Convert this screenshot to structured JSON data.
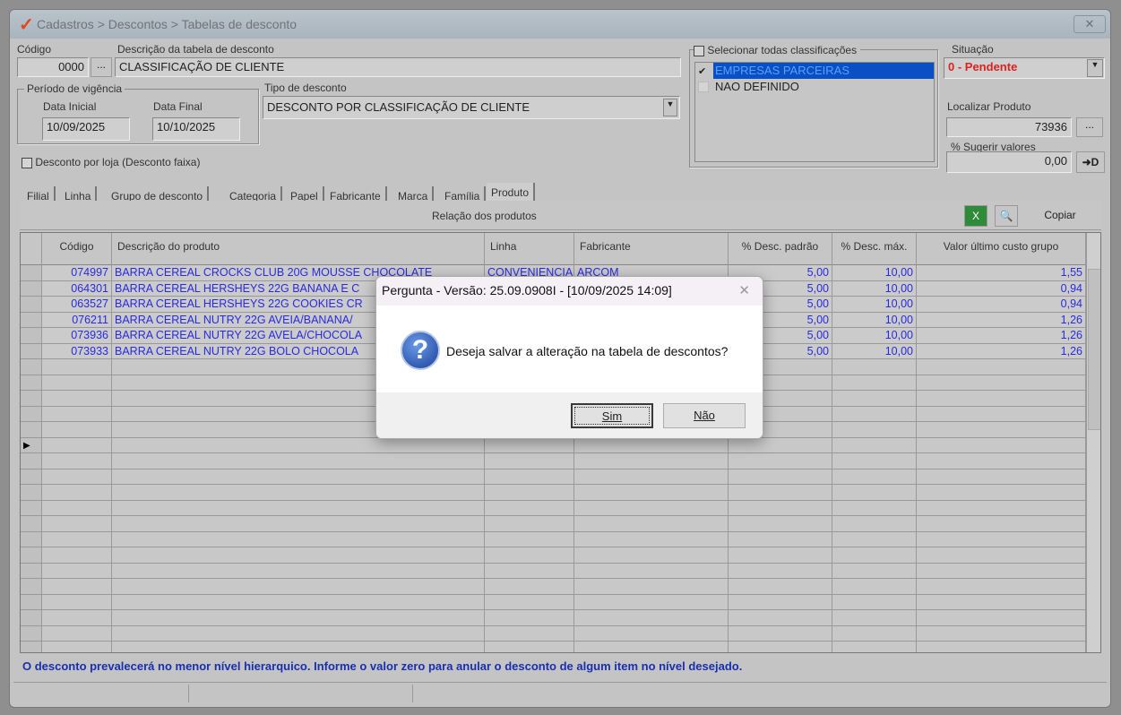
{
  "window": {
    "title": "Cadastros > Descontos > Tabelas de desconto",
    "close_icon": "close-icon"
  },
  "form": {
    "codigo_label": "Código",
    "codigo_value": "0000",
    "lookup_label": "...",
    "descricao_label": "Descrição da tabela de desconto",
    "descricao_value": "CLASSIFICAÇÃO DE CLIENTE",
    "periodo_label": "Período de vigência",
    "data_inicial_label": "Data Inicial",
    "data_inicial_value": "10/09/2025",
    "data_final_label": "Data Final",
    "data_final_value": "10/10/2025",
    "tipo_label": "Tipo de desconto",
    "tipo_value": "DESCONTO POR CLASSIFICAÇÃO DE CLIENTE",
    "desconto_loja_label": "Desconto por loja (Desconto faixa)",
    "selecionar_todas_label": "Selecionar todas classificações",
    "classificacoes": [
      {
        "label": "EMPRESAS PARCEIRAS",
        "checked": true
      },
      {
        "label": "NAO DEFINIDO",
        "checked": false
      }
    ],
    "situacao_label": "Situação",
    "situacao_value": "0 - Pendente",
    "localizar_label": "Localizar Produto",
    "localizar_value": "73936",
    "sugerir_label": "% Sugerir valores",
    "sugerir_value": "0,00",
    "apply_label": "➜D"
  },
  "tabs": [
    "Filial",
    "Linha",
    "Grupo de desconto",
    "Categoria",
    "Papel",
    "Fabricante",
    "Marca",
    "Família",
    "Produto"
  ],
  "active_tab": "Produto",
  "grid": {
    "title": "Relação dos produtos",
    "copy_label": "Copiar",
    "columns": [
      "Código",
      "Descrição do produto",
      "Linha",
      "Fabricante",
      "% Desc. padrão",
      "% Desc. máx.",
      "Valor último custo grupo"
    ],
    "rows": [
      [
        "074997",
        "BARRA CEREAL CROCKS CLUB 20G MOUSSE CHOCOLATE",
        "CONVENIENCIA",
        "ARCOM",
        "5,00",
        "10,00",
        "1,55"
      ],
      [
        "064301",
        "BARRA CEREAL HERSHEYS 22G BANANA E C",
        "",
        "",
        "5,00",
        "10,00",
        "0,94"
      ],
      [
        "063527",
        "BARRA CEREAL HERSHEYS 22G COOKIES CR",
        "",
        "",
        "5,00",
        "10,00",
        "0,94"
      ],
      [
        "076211",
        "BARRA CEREAL NUTRY 22G AVEIA/BANANA/",
        "",
        "",
        "5,00",
        "10,00",
        "1,26"
      ],
      [
        "073936",
        "BARRA CEREAL NUTRY 22G AVELA/CHOCOLA",
        "",
        "",
        "5,00",
        "10,00",
        "1,26"
      ],
      [
        "073933",
        "BARRA CEREAL NUTRY 22G BOLO CHOCOLA",
        "",
        "",
        "5,00",
        "10,00",
        "1,26"
      ]
    ]
  },
  "footer_message": "O desconto prevalecerá no menor nível hierarquico. Informe o valor zero para anular o desconto de algum item no nível desejado.",
  "dialog": {
    "title": "Pergunta - Versão: 25.09.0908I - [10/09/2025 14:09]",
    "message": "Deseja salvar a alteração na tabela de descontos?",
    "yes_label": "Sim",
    "no_label": "Não",
    "close_label": "✕"
  },
  "colors": {
    "accent": "#0a4fc4",
    "status_red": "#e02020",
    "row_text": "#2a2ae0"
  }
}
